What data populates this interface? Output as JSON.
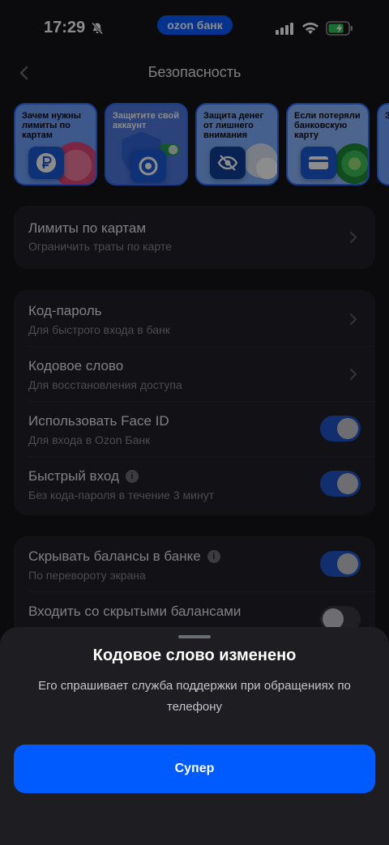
{
  "status_bar": {
    "time": "17:29",
    "brand": "ozon банк",
    "icons": [
      "bell-off-icon",
      "signal-icon",
      "wifi-icon",
      "battery-charging-icon"
    ]
  },
  "header": {
    "title": "Безопасность",
    "back_icon": "chevron-left-icon"
  },
  "stories": [
    {
      "label": "Зачем нужны лимиты по картам",
      "icon": "ruble-icon",
      "color": "#6fa2ff"
    },
    {
      "label": "Защитите свой аккаунт",
      "icon": "shield-icon",
      "color": "#4f78e0"
    },
    {
      "label": "Защита денег от лишнего внимания",
      "icon": "eye-off-icon",
      "color": "#7fb0ff"
    },
    {
      "label": "Если потеряли банковскую карту",
      "icon": "card-icon",
      "color": "#8db7ff"
    },
    {
      "label": "З",
      "icon": "",
      "color": "#6fa2ff"
    }
  ],
  "cards": {
    "limits": {
      "title": "Лимиты по картам",
      "subtitle": "Ограничить траты по карте"
    },
    "passcode": {
      "title": "Код-пароль",
      "subtitle": "Для быстрого входа в банк"
    },
    "code_word": {
      "title": "Кодовое слово",
      "subtitle": "Для восстановления доступа"
    },
    "face_id": {
      "title": "Использовать Face ID",
      "subtitle": "Для входа в Ozon Банк",
      "enabled": true
    },
    "quick_login": {
      "title": "Быстрый вход",
      "subtitle": "Без кода-пароля в течение 3 минут",
      "enabled": true
    },
    "hide_balances": {
      "title": "Скрывать балансы в банке",
      "subtitle": "По перевороту экрана",
      "enabled": true
    },
    "hidden_login": {
      "title": "Входить со скрытыми балансами",
      "enabled": false
    }
  },
  "sheet": {
    "title": "Кодовое слово изменено",
    "text": "Его спрашивает служба поддержки при обращениях по телефону",
    "button": "Супер"
  },
  "colors": {
    "accent": "#005bff",
    "background": "#141418",
    "card": "#222228"
  }
}
